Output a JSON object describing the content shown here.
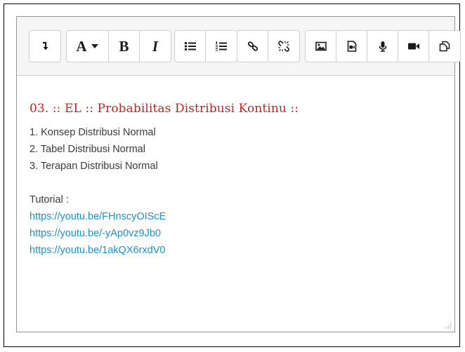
{
  "toolbar": {
    "buttons": [
      {
        "name": "show-more-buttons",
        "icon": "show-more-icon"
      },
      {
        "name": "paragraph-styles",
        "label": "A",
        "icon": "caret-down-icon"
      },
      {
        "name": "bold",
        "label": "B"
      },
      {
        "name": "italic",
        "label": "I"
      },
      {
        "name": "unordered-list",
        "icon": "bullet-list-icon"
      },
      {
        "name": "ordered-list",
        "icon": "numbered-list-icon"
      },
      {
        "name": "link",
        "icon": "link-icon"
      },
      {
        "name": "unlink",
        "icon": "unlink-icon"
      },
      {
        "name": "insert-image",
        "icon": "image-icon"
      },
      {
        "name": "insert-media",
        "icon": "media-file-icon"
      },
      {
        "name": "record-audio",
        "icon": "microphone-icon"
      },
      {
        "name": "record-video",
        "icon": "video-camera-icon"
      },
      {
        "name": "manage-files",
        "icon": "files-icon"
      }
    ]
  },
  "content": {
    "heading": "03. :: EL :: Probabilitas Distribusi Kontinu ::",
    "list_items": [
      "1. Konsep Distribusi Normal",
      "2. Tabel Distribusi Normal",
      "3. Terapan Distribusi Normal"
    ],
    "tutorial_label": "Tutorial :",
    "links": [
      "https://youtu.be/FHnscyOIScE",
      "https://youtu.be/-yAp0vz9Jb0",
      "https://youtu.be/1akQX6rxdV0"
    ]
  },
  "colors": {
    "heading": "#c0251c",
    "link": "#1a8fcf",
    "text": "#3b3b3b",
    "toolbar_bg": "#f5f5f5",
    "border": "#8f959e"
  }
}
